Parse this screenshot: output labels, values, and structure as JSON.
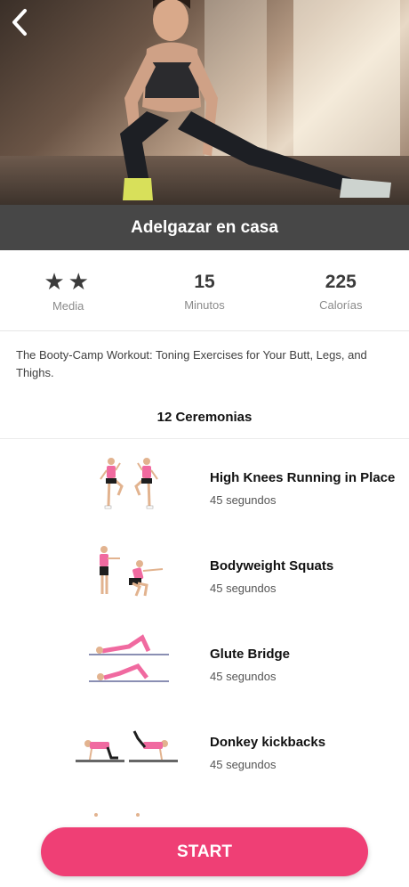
{
  "header": {
    "title": "Adelgazar en casa",
    "back_icon": "chevron-left-icon"
  },
  "stats": [
    {
      "value": "★★",
      "label": "Media"
    },
    {
      "value": "15",
      "label": "Minutos"
    },
    {
      "value": "225",
      "label": "Calorías"
    }
  ],
  "description": "The Booty-Camp Workout: Toning Exercises for Your Butt, Legs, and Thighs.",
  "exercise_count": "12 Ceremonias",
  "exercises": [
    {
      "name": "High Knees Running in Place",
      "duration": "45 segundos"
    },
    {
      "name": "Bodyweight Squats",
      "duration": "45 segundos"
    },
    {
      "name": "Glute Bridge",
      "duration": "45 segundos"
    },
    {
      "name": "Donkey kickbacks",
      "duration": "45 segundos"
    }
  ],
  "start_label": "START",
  "colors": {
    "accent": "#ef3f75",
    "title_bar": "#474747",
    "figure_top": "#f06aa0",
    "figure_skin": "#f2c9a8"
  }
}
